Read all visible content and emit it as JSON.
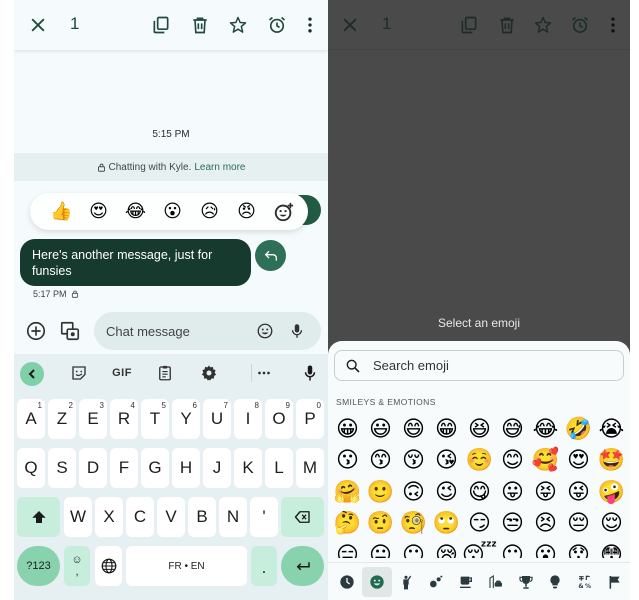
{
  "left_screen": {
    "topbar": {
      "close_icon": "close-icon",
      "selected_count": "1",
      "actions": [
        "copy-icon",
        "delete-icon",
        "star-icon",
        "alarm-icon",
        "more-vert-icon"
      ]
    },
    "timestamp": "5:15 PM",
    "banner": {
      "text": "Chatting with Kyle.",
      "link": "Learn more",
      "icon": "lock-icon"
    },
    "reactions": [
      {
        "name": "thumbs-up",
        "glyph": "👍"
      },
      {
        "name": "heart-eyes",
        "glyph": "😍"
      },
      {
        "name": "tears-of-joy",
        "glyph": "😂"
      },
      {
        "name": "surprised",
        "glyph": "😮"
      },
      {
        "name": "sad-sweat",
        "glyph": "😥"
      },
      {
        "name": "angry",
        "glyph": "😠"
      }
    ],
    "reaction_more_icon": "add-reaction-icon",
    "message": {
      "text": "Here's another message, just for funsies",
      "time": "5:17 PM",
      "status_icon": "lock-icon"
    },
    "compose": {
      "placeholder": "Chat message",
      "value": ""
    },
    "keyboard": {
      "toolbar": {
        "gif_label": "GIF"
      },
      "row1": [
        {
          "k": "A",
          "h": "1"
        },
        {
          "k": "Z",
          "h": "2"
        },
        {
          "k": "E",
          "h": "3"
        },
        {
          "k": "R",
          "h": "4"
        },
        {
          "k": "T",
          "h": "5"
        },
        {
          "k": "Y",
          "h": "6"
        },
        {
          "k": "U",
          "h": "7"
        },
        {
          "k": "I",
          "h": "8"
        },
        {
          "k": "O",
          "h": "9"
        },
        {
          "k": "P",
          "h": "0"
        }
      ],
      "row2": [
        "Q",
        "S",
        "D",
        "F",
        "G",
        "H",
        "J",
        "K",
        "L",
        "M"
      ],
      "row3": [
        "W",
        "X",
        "C",
        "V",
        "B",
        "N",
        "'"
      ],
      "symbols_label": "?123",
      "comma_label": ",",
      "comma_hint": "☺",
      "space_label": "FR • EN",
      "period_label": "."
    }
  },
  "right_screen": {
    "topbar": {
      "selected_count": "1"
    },
    "overlay_title": "Select an emoji",
    "search": {
      "placeholder": "Search emoji",
      "value": ""
    },
    "section_label": "SMILEYS & EMOTIONS",
    "emojis": [
      "😀",
      "😃",
      "😄",
      "😁",
      "😆",
      "😅",
      "😂",
      "🤣",
      "😭",
      "😗",
      "😙",
      "😚",
      "😘",
      "☺️",
      "😊",
      "🥰",
      "😍",
      "🤩",
      "🤗",
      "🙂",
      "🙃",
      "😉",
      "😋",
      "😛",
      "😝",
      "😜",
      "🤪",
      "🤔",
      "🤨",
      "🧐",
      "🙄",
      "😏",
      "😒",
      "😣",
      "😔",
      "😌",
      "😑",
      "😐",
      "😶",
      "😪",
      "😴",
      "😶",
      "😮",
      "😯",
      "😳"
    ],
    "categories": [
      {
        "name": "recent",
        "active": false
      },
      {
        "name": "smileys",
        "active": true
      },
      {
        "name": "people",
        "active": false
      },
      {
        "name": "nature",
        "active": false
      },
      {
        "name": "food",
        "active": false
      },
      {
        "name": "travel",
        "active": false
      },
      {
        "name": "activities",
        "active": false
      },
      {
        "name": "objects",
        "active": false
      },
      {
        "name": "symbols",
        "active": false
      },
      {
        "name": "flags",
        "active": false
      }
    ]
  }
}
